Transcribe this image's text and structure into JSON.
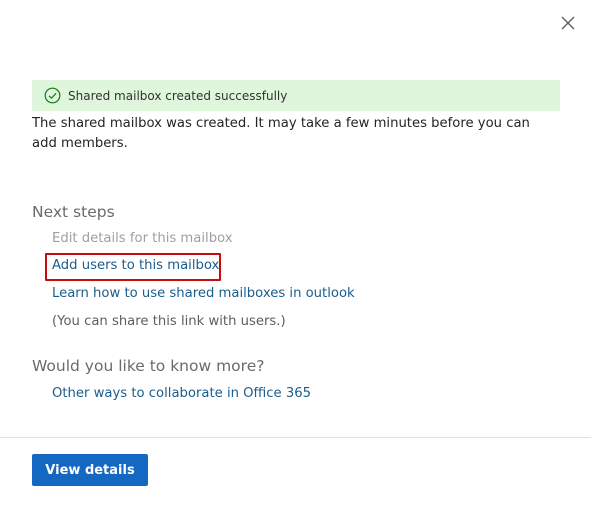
{
  "banner": {
    "icon": "check-circle-icon",
    "message": "Shared mailbox created successfully",
    "color": "#dff6dd"
  },
  "description": "The shared mailbox was created. It may take a few minutes before you can add members.",
  "next_steps": {
    "heading": "Next steps",
    "edit_details": "Edit details for this mailbox",
    "add_users": "Add users to this mailbox",
    "learn_how": "Learn how to use shared mailboxes in outlook",
    "share_note": "(You can share this link with users.)"
  },
  "more": {
    "heading": "Would you like to know more?",
    "other_ways": "Other ways to collaborate in Office 365"
  },
  "footer": {
    "view_details": "View details"
  },
  "colors": {
    "link": "#1b5d8c",
    "primary_button": "#1568c2",
    "highlight": "#c40d0d"
  }
}
